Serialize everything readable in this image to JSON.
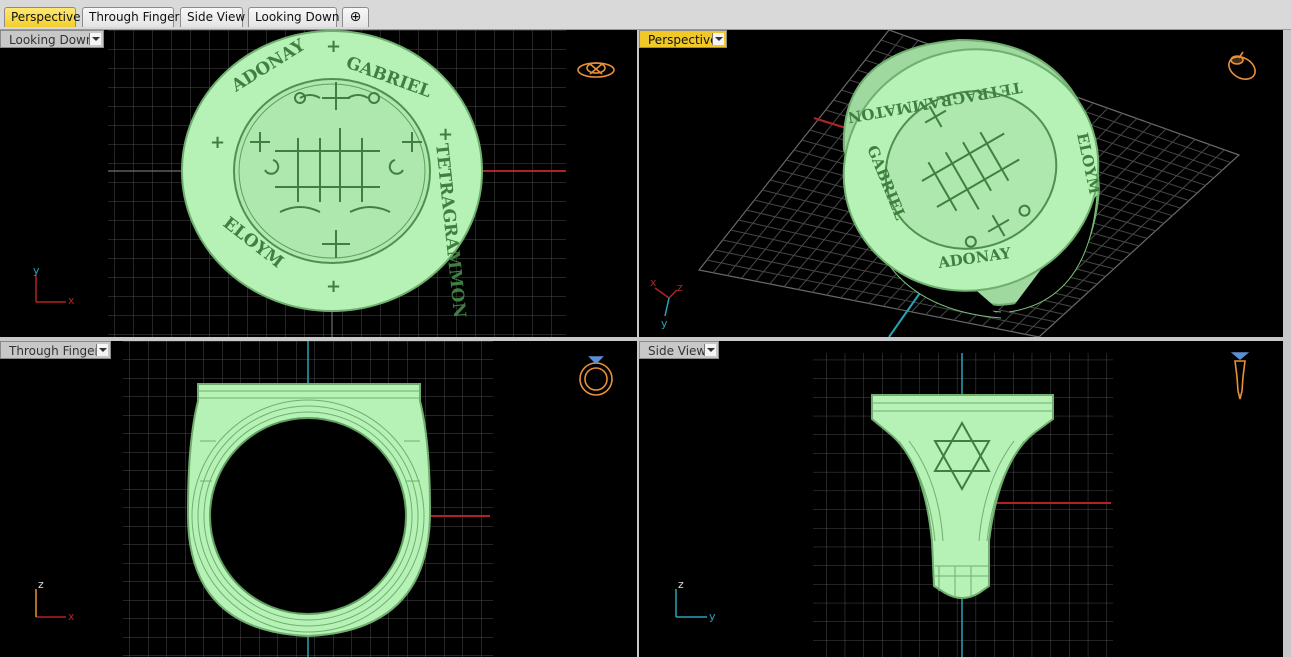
{
  "tabs": [
    {
      "label": "Perspective",
      "active": true
    },
    {
      "label": "Through Finger",
      "active": false
    },
    {
      "label": "Side View",
      "active": false
    },
    {
      "label": "Looking Down",
      "active": false
    }
  ],
  "add_tab_icon": "plus-icon",
  "viewports": {
    "looking_down": {
      "label": "Looking Down",
      "axis": {
        "h": "x",
        "v": "y"
      },
      "ring_inscriptions": {
        "top": "ADONAY",
        "right": "TETRAGRAMMON",
        "left": "ELOYM",
        "upper_right": "GABRIEL"
      }
    },
    "perspective": {
      "label": "Perspective",
      "active": true,
      "axis": {
        "a": "x",
        "b": "z",
        "c": "y"
      },
      "ring_inscriptions": {
        "bottom": "ADONAY",
        "left": "GABRIEL",
        "right": "ELOYM",
        "top": "TETRAGRAMMATON"
      }
    },
    "through_finger": {
      "label": "Through Finger",
      "axis": {
        "h": "x",
        "v": "z"
      }
    },
    "side_view": {
      "label": "Side View",
      "axis": {
        "h": "y",
        "v": "z"
      }
    }
  },
  "colors": {
    "viewport_bg": "#000000",
    "grid": "#5a5a5a",
    "model": "#b6f2b6",
    "model_line": "#5fa05f",
    "axis_x": "#b22222",
    "axis_y": "#2aa3b8",
    "label_active": "#f0c928",
    "widget": "#e8913a"
  }
}
